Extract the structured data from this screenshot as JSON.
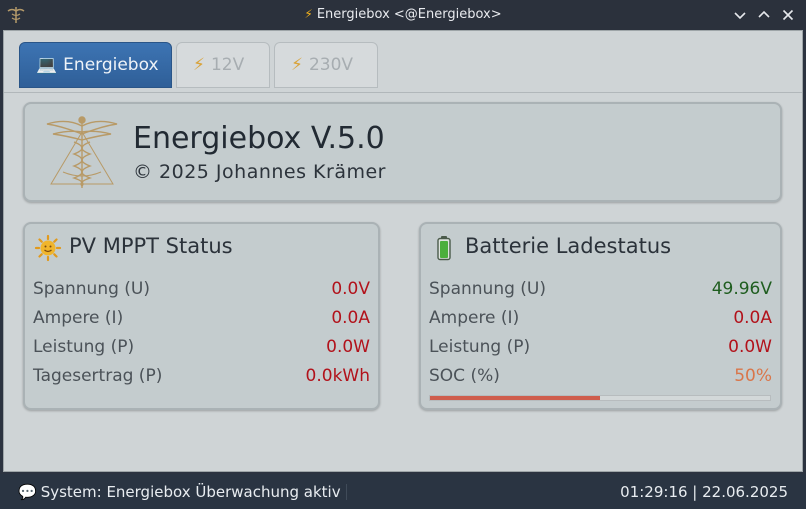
{
  "window": {
    "title": "Energiebox <@Energiebox>",
    "title_icon": "bolt-icon"
  },
  "tabs": [
    {
      "label": "Energiebox",
      "icon": "laptop-icon",
      "active": true
    },
    {
      "label": "12V",
      "icon": "bolt-icon",
      "active": false
    },
    {
      "label": "230V",
      "icon": "bolt-icon",
      "active": false
    }
  ],
  "header": {
    "title": "Energiebox V.5.0",
    "subtitle": "© 2025 Johannes Krämer",
    "logo": "caduceus-logo"
  },
  "pv_card": {
    "title": "PV MPPT Status",
    "icon": "sun-icon",
    "rows": [
      {
        "label": "Spannung (U)",
        "value": "0.0V"
      },
      {
        "label": "Ampere (I)",
        "value": "0.0A"
      },
      {
        "label": "Leistung (P)",
        "value": "0.0W"
      },
      {
        "label": "Tagesertrag (P)",
        "value": "0.0kWh"
      }
    ]
  },
  "battery_card": {
    "title": "Batterie Ladestatus",
    "icon": "battery-icon",
    "rows": [
      {
        "label": "Spannung (U)",
        "value": "49.96V"
      },
      {
        "label": "Ampere (I)",
        "value": "0.0A"
      },
      {
        "label": "Leistung (P)",
        "value": "0.0W"
      },
      {
        "label": "SOC (%)",
        "value": "50%"
      }
    ],
    "soc_fraction": 0.5
  },
  "status_bar": {
    "message": "System: Energiebox Überwachung aktiv",
    "datetime": "01:29:16 | 22.06.2025"
  },
  "colors": {
    "active_tab": "#3d74b3",
    "value_red": "#b2121b",
    "value_green": "#1f5d1f",
    "soc_orange": "#d9764a",
    "soc_bar": "#cf5d4d"
  }
}
